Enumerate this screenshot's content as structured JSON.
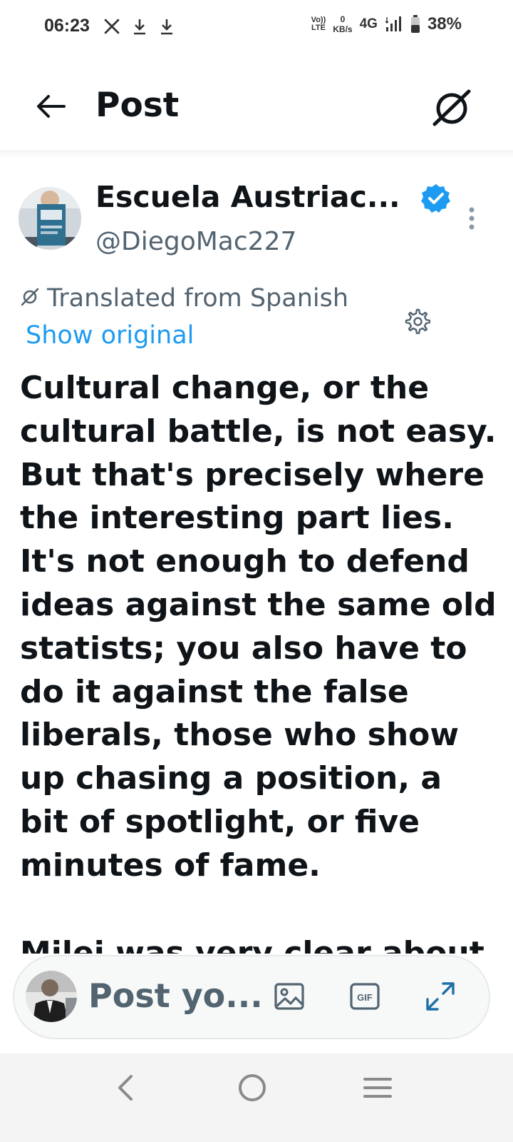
{
  "status_bar": {
    "time": "06:23",
    "left_icons": [
      "x-logo-icon",
      "download-icon",
      "download-icon"
    ],
    "volte_top": "Vo))",
    "volte_bottom": "LTE",
    "speed_value": "0",
    "speed_unit": "KB/s",
    "network": "4G",
    "battery": "38%"
  },
  "header": {
    "title": "Post"
  },
  "author": {
    "name": "Escuela Austriac...",
    "handle": "@DiegoMac227",
    "verified": true
  },
  "translation": {
    "label": "Translated from Spanish",
    "show_original": "Show original"
  },
  "post": {
    "text": "Cultural change, or the\ncultural battle, is not easy.\nBut that's precisely where\nthe interesting part lies.\nIt's not enough to defend\nideas against the same old\nstatists; you also have to\ndo it against the false\nliberals, those who show\nup chasing a position, a\nbit of spotlight, or five\nminutes of fame.",
    "continued": "Milei was very clear about"
  },
  "composer": {
    "placeholder": "Post yo..."
  },
  "colors": {
    "accent": "#1d9bf0",
    "text": "#0f1419",
    "secondary": "#536471"
  }
}
